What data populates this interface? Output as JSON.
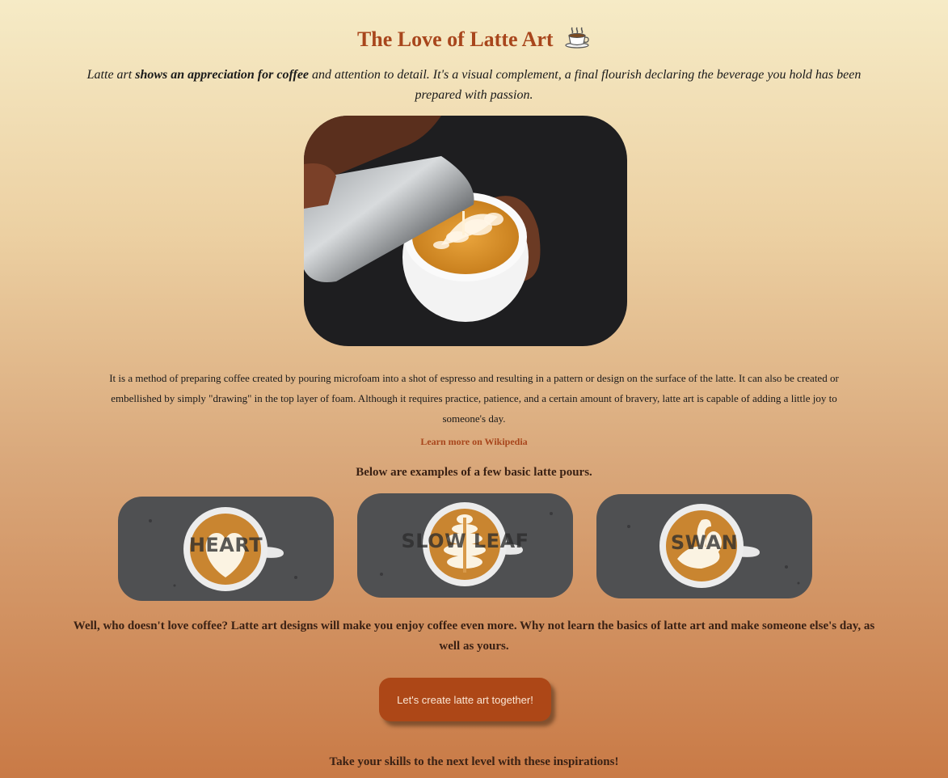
{
  "header": {
    "title": "The Love of Latte Art",
    "title_icon": "coffee-cup-icon"
  },
  "intro": {
    "part1": "Latte art ",
    "emphasis": "shows an appreciation for coffee",
    "part2": " and attention to detail. It's a visual complement, a final flourish declaring the beverage you hold has been prepared with passion."
  },
  "hero_image": {
    "description_icon": "latte-pour-photo"
  },
  "description": "It is a method of preparing coffee created by pouring microfoam into a shot of espresso and resulting in a pattern or design on the surface of the latte. It can also be created or embellished by simply \"drawing\" in the top layer of foam. Although it requires practice, patience, and a certain amount of bravery, latte art is capable of adding a little joy to someone's day.",
  "wiki_link": "Learn more on Wikipedia",
  "examples": {
    "title": "Below are examples of a few basic latte pours.",
    "items": [
      {
        "label": "HEART"
      },
      {
        "label": "SLOW LEAF"
      },
      {
        "label": "SWAN"
      }
    ]
  },
  "closing": "Well, who doesn't love coffee? Latte art designs will make you enjoy coffee even more. Why not learn the basics of latte art and make someone else's day, as well as yours.",
  "cta": {
    "label": "Let's create latte art together!"
  },
  "next_section": "Take your skills to the next level with these inspirations!",
  "colors": {
    "accent": "#a8461c",
    "button": "#ad4717",
    "background_top": "#f6ebc6",
    "background_bottom": "#c97a46"
  }
}
